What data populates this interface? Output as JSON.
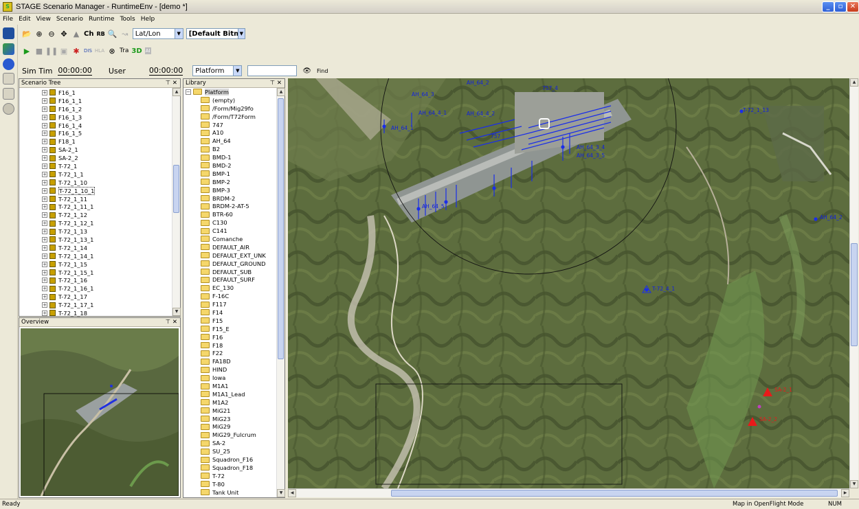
{
  "window": {
    "title": "STAGE Scenario Manager - RuntimeEnv - [demo *]",
    "icon_letter": "S"
  },
  "menu": [
    "File",
    "Edit",
    "View",
    "Scenario",
    "Runtime",
    "Tools",
    "Help"
  ],
  "toolbar1": {
    "ch": "Ch",
    "rb": "RB",
    "projection": "Lat/Lon",
    "bitmap": "[Default Bitmap"
  },
  "toolbar2": {
    "dis": "DIS",
    "hla": "HLA",
    "tra": "Tra",
    "threed": "3D",
    "ai": "AI"
  },
  "simbar": {
    "simtime_label": "Sim Tim",
    "simtime_value": "00:00:00",
    "user_label": "User",
    "user_value": "00:00:00",
    "category": "Platform",
    "find_label": "Find"
  },
  "scenario_tree": {
    "title": "Scenario Tree",
    "items": [
      "F16_1",
      "F16_1_1",
      "F16_1_2",
      "F16_1_3",
      "F16_1_4",
      "F16_1_5",
      "F18_1",
      "SA-2_1",
      "SA-2_2",
      "T-72_1",
      "T-72_1_1",
      "T-72_1_10",
      "T-72_1_10_1",
      "T-72_1_11",
      "T-72_1_11_1",
      "T-72_1_12",
      "T-72_1_12_1",
      "T-72_1_13",
      "T-72_1_13_1",
      "T-72_1_14",
      "T-72_1_14_1",
      "T-72_1_15",
      "T-72_1_15_1",
      "T-72_1_16",
      "T-72_1_16_1",
      "T-72_1_17",
      "T-72_1_17_1",
      "T-72_1_18"
    ],
    "selected": "T-72_1_10_1"
  },
  "overview": {
    "title": "Overview"
  },
  "library": {
    "title": "Library",
    "root": "Platform",
    "items": [
      "(empty)",
      "/Form/Mig29fo",
      "/Form/T72Form",
      "747",
      "A10",
      "AH_64",
      "B2",
      "BMD-1",
      "BMD-2",
      "BMP-1",
      "BMP-2",
      "BMP-3",
      "BRDM-2",
      "BRDM-2-AT-5",
      "BTR-60",
      "C130",
      "C141",
      "Comanche",
      "DEFAULT_AIR",
      "DEFAULT_EXT_UNK",
      "DEFAULT_GROUND",
      "DEFAULT_SUB",
      "DEFAULT_SURF",
      "EC_130",
      "F-16C",
      "F117",
      "F14",
      "F15",
      "F15_E",
      "F16",
      "F18",
      "F22",
      "FA18D",
      "HIND",
      "Iowa",
      "M1A1",
      "M1A1_Lead",
      "M1A2",
      "MiG21",
      "MiG23",
      "MiG29",
      "MiG29_Fulcrum",
      "SA-2",
      "SU_25",
      "Squadron_F16",
      "Squadron_F18",
      "T-72",
      "T-80",
      "Tank Unit"
    ]
  },
  "map": {
    "blue_labels": [
      "AH_64_3",
      "AH_64_2",
      "AH_64_1",
      "757_4",
      "AH_64_4_1",
      "AH_64_4_2",
      "757",
      "AH_64_3_4",
      "AH_64_3_5",
      "AH_64_5",
      "T-72_1_13",
      "T-72_4_1",
      "AH_64_2"
    ],
    "red_labels": [
      "SA-2_1",
      "SA-2_2"
    ],
    "colors": {
      "friendly": "#1a2ee8",
      "hostile": "#e81a1a"
    }
  },
  "status": {
    "left": "Ready",
    "mode": "Map in OpenFlight Mode",
    "num": "NUM"
  }
}
